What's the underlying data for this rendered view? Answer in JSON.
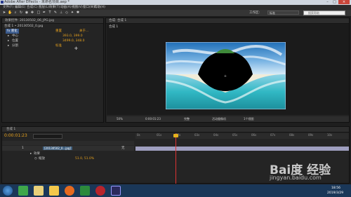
{
  "window": {
    "title": "Adobe After Effects - 未命名项目.aep *"
  },
  "menu": [
    "文件(F)",
    "编辑(E)",
    "合成(C)",
    "图层(L)",
    "效果(T)",
    "动画(A)",
    "视图(V)",
    "窗口(W)",
    "帮助(H)"
  ],
  "toolbar": {
    "workspace_label": "工作区:",
    "workspace_value": "标准",
    "search_placeholder": "搜索帮助"
  },
  "effects_panel": {
    "tab": "效果控件: 20130502_06_JPG.jpg",
    "layer_path": "合成 1 • 20130502_0.jpg",
    "rows": [
      {
        "label": "fx 液化",
        "action": "重置",
        "extra": "关于..."
      },
      {
        "label": "中心",
        "value": "393.0, 399.0"
      },
      {
        "label": "位置",
        "value": "3499.0, 348.0"
      },
      {
        "label": "分割",
        "value": "标准"
      }
    ]
  },
  "viewer": {
    "tab": "合成: 合成 1",
    "comp_name": "合成 1",
    "zoom": "50%",
    "timecode": "0:00:01:23",
    "resolution": "完整",
    "camera": "活动摄像机",
    "views": "1个视图"
  },
  "timeline": {
    "tab": "合成 1",
    "timecode": "0:00:01:23",
    "ruler": [
      "0s",
      "01s",
      "02s",
      "03s",
      "04s",
      "05s",
      "06s",
      "07s",
      "08s",
      "09s",
      "10s"
    ],
    "layers": [
      {
        "num": "1",
        "name": "[20130502_0...jpg]",
        "mode": "无"
      },
      {
        "num": "",
        "name": "效果",
        "mode": ""
      },
      {
        "num": "",
        "name": "缩放",
        "value": "51.0, 51.0%"
      }
    ]
  },
  "taskbar": {
    "time": "18:56",
    "date": "2019/3/29"
  },
  "watermark": {
    "brand": "Bai度 经验",
    "url": "jingyan.baidu.com"
  }
}
